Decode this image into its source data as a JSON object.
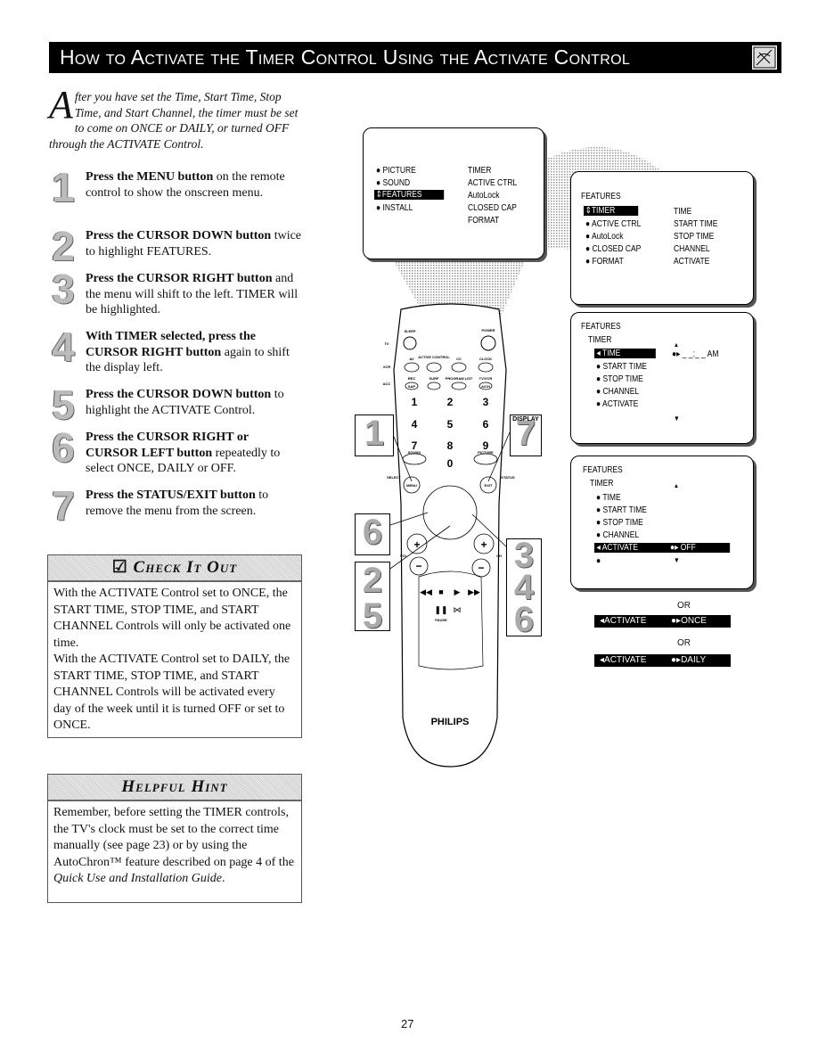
{
  "header": {
    "title": "How to Activate the Timer Control Using the Activate Control",
    "icon": "remote-hand-icon"
  },
  "intro": {
    "drop_cap": "A",
    "text": "fter you have set the Time, Start Time, Stop Time, and Start Channel, the timer must be set to come on ONCE or DAILY, or turned OFF through the ACTIVATE Control."
  },
  "steps": [
    {
      "num": "1",
      "bold": "Press the MENU button",
      "rest": " on the remote control to show the onscreen menu."
    },
    {
      "num": "2",
      "bold": "Press the CURSOR DOWN button",
      "rest": " twice to highlight FEATURES."
    },
    {
      "num": "3",
      "bold": "Press the CURSOR RIGHT button",
      "rest": " and the menu will shift to the left. TIMER will be highlighted."
    },
    {
      "num": "4",
      "bold": "With TIMER selected, press the CURSOR RIGHT button",
      "rest": " again to shift the display left."
    },
    {
      "num": "5",
      "bold": "Press the CURSOR DOWN button",
      "rest": " to highlight the ACTIVATE Control."
    },
    {
      "num": "6",
      "bold": "Press the CURSOR RIGHT or CURSOR LEFT button",
      "rest": " repeatedly to select ONCE, DAILY or OFF."
    },
    {
      "num": "7",
      "bold": "Press the STATUS/EXIT button",
      "rest": " to remove the menu from the screen."
    }
  ],
  "check_it_out": {
    "title": "Check It Out",
    "icon": "checkbox-icon",
    "text": "With the ACTIVATE Control set to ONCE, the START TIME, STOP TIME, and START CHANNEL Controls will only be activated one time.",
    "text2": "With the ACTIVATE Control set to DAILY, the START TIME, STOP TIME, and START CHANNEL Controls will be activated every day of the week until it is turned OFF or set to ONCE."
  },
  "helpful_hint": {
    "title": "Helpful Hint",
    "text": "Remember, before setting the TIMER controls, the TV's clock must be set to the correct time manually (see page 23) or by using the AutoChron™ feature described on page 4 of the ",
    "italic": "Quick Use and Installation Guide",
    "end": "."
  },
  "screen1": {
    "left": [
      "PICTURE",
      "SOUND",
      "FEATURES",
      "INSTALL"
    ],
    "right": [
      "TIMER",
      "ACTIVE CTRL",
      "AutoLock",
      "CLOSED CAP",
      "FORMAT"
    ]
  },
  "screen2": {
    "title": "FEATURES",
    "left": [
      "TIMER",
      "ACTIVE CTRL",
      "AutoLock",
      "CLOSED CAP",
      "FORMAT"
    ],
    "right": [
      "TIME",
      "START TIME",
      "STOP TIME",
      "CHANNEL",
      "ACTIVATE"
    ]
  },
  "screen3": {
    "title": "FEATURES",
    "sub": "TIMER",
    "items": [
      "TIME",
      "START TIME",
      "STOP TIME",
      "CHANNEL",
      "ACTIVATE"
    ],
    "value": "_ _:_ _ AM"
  },
  "screen4": {
    "title": "FEATURES",
    "sub": "TIMER",
    "items": [
      "TIME",
      "START TIME",
      "STOP TIME",
      "CHANNEL",
      "ACTIVATE"
    ],
    "value": "OFF"
  },
  "options": {
    "or": "OR",
    "label": "ACTIVATE",
    "once": "ONCE",
    "daily": "DAILY"
  },
  "remote": {
    "brand": "PHILIPS",
    "labels": {
      "sleep": "SLEEP",
      "power": "POWER",
      "tv": "TV",
      "vcr": "VCR",
      "acc": "ACC",
      "av": "AV",
      "active_control": "ACTIVE CONTROL",
      "cc": "CC",
      "clock": "CLOCK",
      "rec": "REC",
      "sap": "SAP",
      "surf": "SURF",
      "program_list": "PROGRAM LIST",
      "tvvcr": "TV/VCR",
      "ach": "A/CH",
      "sound": "SOUND",
      "picture": "PICTURE",
      "menu": "MENU",
      "select": "SELECT",
      "exit": "EXIT",
      "status": "STATUS",
      "display": "DISPLAY",
      "vol": "VOL",
      "ch": "CH",
      "pause": "PAUSE"
    },
    "digits": [
      "1",
      "2",
      "3",
      "4",
      "5",
      "6",
      "7",
      "8",
      "9",
      "0"
    ]
  },
  "callouts": {
    "left_top": "1",
    "right_top": "7",
    "left_mid": "6",
    "left_low": [
      "2",
      "5"
    ],
    "right_low": [
      "3",
      "4",
      "6"
    ]
  },
  "page_number": "27"
}
